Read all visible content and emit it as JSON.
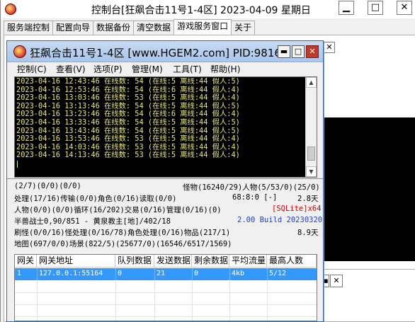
{
  "outer": {
    "title": "控制台[狂飙合击11号1-4区] 2023-04-09 星期日",
    "minimize": "▁",
    "maximize": "□",
    "close": "✕",
    "tabs": [
      "服务端控制",
      "配置向导",
      "数据备份",
      "清空数据",
      "游戏服务窗口",
      "关于"
    ],
    "active_tab": "游戏服务窗口",
    "stub_close": "✕",
    "stub_btn1": "▪",
    "stub_btn2": "✕"
  },
  "inner": {
    "title": "狂飙合击11号1-4区 [www.HGEM2.com] PID:9816",
    "minimize": "▬",
    "maximize": "□",
    "close": "✕",
    "menu": [
      "控制(C)",
      "查看(V)",
      "选项(P)",
      "管理(M)",
      "工具(T)",
      "帮助(H)"
    ],
    "console_lines": [
      "2023-04-16 12:43:46 在线数: 54 (在线:5 离线:44 假人:5)",
      "2023-04-16 12:53:46 在线数: 54 (在线:6 离线:44 假人:4)",
      "2023-04-16 13:03:46 在线数: 53 (在线:5 离线:44 假人:4)",
      "2023-04-16 13:13:46 在线数: 54 (在线:5 离线:44 假人:5)",
      "2023-04-16 13:23:46 在线数: 54 (在线:6 离线:44 假人:4)",
      "2023-04-16 13:33:46 在线数: 54 (在线:5 离线:44 假人:5)",
      "2023-04-16 13:43:46 在线数: 54 (在线:5 离线:44 假人:5)",
      "2023-04-16 13:53:46 在线数: 53 (在线:5 离线:44 假人:4)",
      "2023-04-16 14:03:46 在线数: 53 (在线:5 离线:44 假人:4)",
      "2023-04-16 14:13:46 在线数: 53 (在线:5 离线:44 假人:4)"
    ],
    "status": {
      "l1_left": "(2/7)(0/0)(0/0)",
      "l1_right": "怪物(16240/29)人物(5/53/0)(25/0)",
      "l2_left": "处理(17/16)传输(0/0)角色(0/16)读取(0/0)",
      "l2_mid": "68:8:0 [-]",
      "l2_right": "2.8天",
      "l3_left": "人物(0/0)(0/0)循环(16/202)交易(0/16)管理(0/16)(0)",
      "l3_right": "[SQLite]x64",
      "l4_left": "半兽战士0,90/851 - 黄泉教主[地]/402/18",
      "l4_right": "2.00 Build 20230320",
      "l5_left": "刷怪(0/0/16)怪处理(0/16/78)角色处理(0/16)物品(217/1)",
      "l5_right": "8.9天",
      "l6_left": "地图(697/0/0)场景(822/5)(25677/0)(16546/6517/1569)"
    },
    "table": {
      "headers": [
        "网关",
        "网关地址",
        "队列数据",
        "发送数据",
        "剩余数据",
        "平均流量",
        "最高人数"
      ],
      "rows": [
        [
          "1",
          "127.0.0.1:55164",
          "0",
          "21",
          "0",
          "4kb",
          "5/12"
        ]
      ]
    }
  },
  "colors": {
    "console_text": "#e8e87a",
    "console_bg": "#000000",
    "selection": "#3399ff",
    "sqlite": "#d40000",
    "build": "#1f3fd8"
  }
}
